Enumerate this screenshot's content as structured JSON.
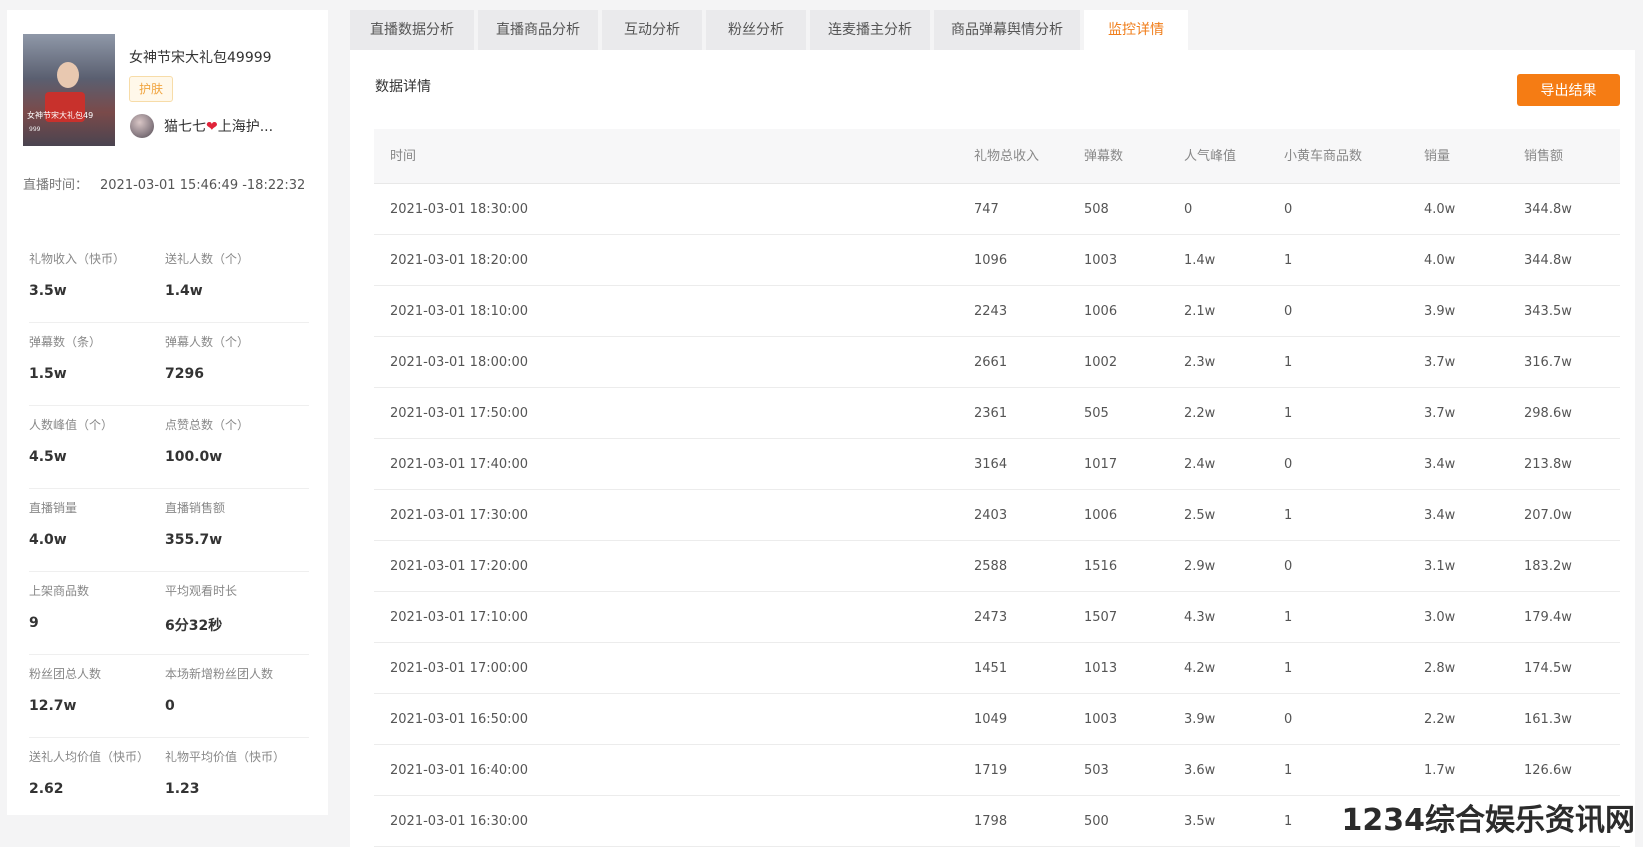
{
  "stream": {
    "title": "女神节宋大礼包49999",
    "tag": "护肤",
    "anchor": "猫七七",
    "heart": "❤",
    "anchor_suffix": "上海护...",
    "thumbnail_caption": "女神节宋大礼包49",
    "thumbnail_subcaption": "999",
    "live_time_label": "直播时间：",
    "live_time_value": "2021-03-01 15:46:49 -18:22:32"
  },
  "stats": [
    [
      {
        "label": "礼物收入（快币）",
        "value": "3.5w"
      },
      {
        "label": "送礼人数（个）",
        "value": "1.4w"
      }
    ],
    [
      {
        "label": "弹幕数（条）",
        "value": "1.5w"
      },
      {
        "label": "弹幕人数（个）",
        "value": "7296"
      }
    ],
    [
      {
        "label": "人数峰值（个）",
        "value": "4.5w"
      },
      {
        "label": "点赞总数（个）",
        "value": "100.0w"
      }
    ],
    [
      {
        "label": "直播销量",
        "value": "4.0w"
      },
      {
        "label": "直播销售额",
        "value": "355.7w"
      }
    ],
    [
      {
        "label": "上架商品数",
        "value": "9"
      },
      {
        "label": "平均观看时长",
        "value": "6分32秒"
      }
    ],
    [
      {
        "label": "粉丝团总人数",
        "value": "12.7w"
      },
      {
        "label": "本场新增粉丝团人数",
        "value": "0"
      }
    ],
    [
      {
        "label": "送礼人均价值（快币）",
        "value": "2.62"
      },
      {
        "label": "礼物平均价值（快币）",
        "value": "1.23"
      }
    ]
  ],
  "tabs": [
    "直播数据分析",
    "直播商品分析",
    "互动分析",
    "粉丝分析",
    "连麦播主分析",
    "商品弹幕舆情分析",
    "监控详情"
  ],
  "active_tab_index": 6,
  "section_title": "数据详情",
  "export_label": "导出结果",
  "table": {
    "headers": [
      "时间",
      "礼物总收入",
      "弹幕数",
      "人气峰值",
      "小黄车商品数",
      "销量",
      "销售额"
    ],
    "rows": [
      [
        "2021-03-01 18:30:00",
        "747",
        "508",
        "0",
        "0",
        "4.0w",
        "344.8w"
      ],
      [
        "2021-03-01 18:20:00",
        "1096",
        "1003",
        "1.4w",
        "1",
        "4.0w",
        "344.8w"
      ],
      [
        "2021-03-01 18:10:00",
        "2243",
        "1006",
        "2.1w",
        "0",
        "3.9w",
        "343.5w"
      ],
      [
        "2021-03-01 18:00:00",
        "2661",
        "1002",
        "2.3w",
        "1",
        "3.7w",
        "316.7w"
      ],
      [
        "2021-03-01 17:50:00",
        "2361",
        "505",
        "2.2w",
        "1",
        "3.7w",
        "298.6w"
      ],
      [
        "2021-03-01 17:40:00",
        "3164",
        "1017",
        "2.4w",
        "0",
        "3.4w",
        "213.8w"
      ],
      [
        "2021-03-01 17:30:00",
        "2403",
        "1006",
        "2.5w",
        "1",
        "3.4w",
        "207.0w"
      ],
      [
        "2021-03-01 17:20:00",
        "2588",
        "1516",
        "2.9w",
        "0",
        "3.1w",
        "183.2w"
      ],
      [
        "2021-03-01 17:10:00",
        "2473",
        "1507",
        "4.3w",
        "1",
        "3.0w",
        "179.4w"
      ],
      [
        "2021-03-01 17:00:00",
        "1451",
        "1013",
        "4.2w",
        "1",
        "2.8w",
        "174.5w"
      ],
      [
        "2021-03-01 16:50:00",
        "1049",
        "1003",
        "3.9w",
        "0",
        "2.2w",
        "161.3w"
      ],
      [
        "2021-03-01 16:40:00",
        "1719",
        "503",
        "3.6w",
        "1",
        "1.7w",
        "126.6w"
      ],
      [
        "2021-03-01 16:30:00",
        "1798",
        "500",
        "3.5w",
        "1",
        "",
        ""
      ]
    ]
  },
  "watermark": "1234综合娱乐资讯网",
  "colors": {
    "accent": "#f57c14",
    "tag_text": "#f0a540",
    "heart": "#e0243a"
  }
}
